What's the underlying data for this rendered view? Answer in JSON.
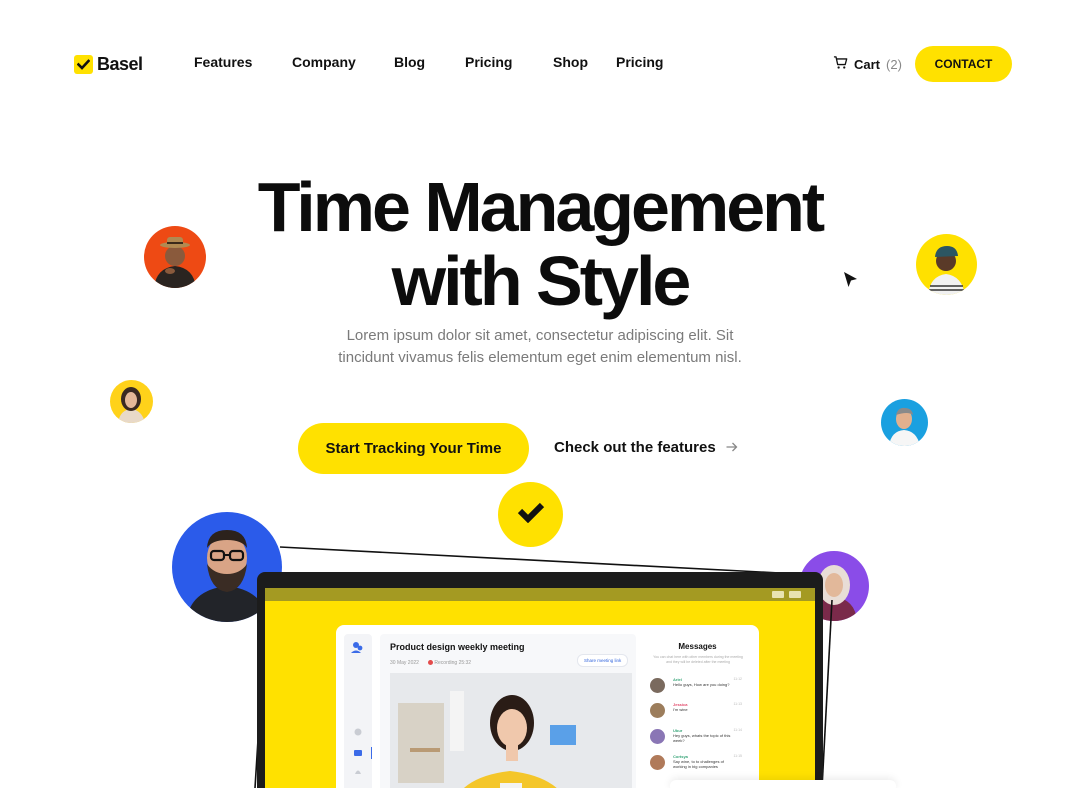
{
  "brand": {
    "name": "Basel",
    "accent": "#ffe100"
  },
  "nav": {
    "links": [
      "Features",
      "Company",
      "Blog",
      "Pricing",
      "Shop",
      "Pricing"
    ],
    "cart_label": "Cart",
    "cart_count": "(2)",
    "contact_label": "CONTACT"
  },
  "hero": {
    "headline_line1": "Time Management",
    "headline_line2": "with Style",
    "subtext": "Lorem ipsum dolor sit amet, consectetur adipiscing elit. Sit tincidunt vivamus felis elementum eget enim elementum nisl.",
    "primary_cta": "Start Tracking Your Time",
    "secondary_cta": "Check out the features"
  },
  "app": {
    "meeting_title": "Product design weekly meeting",
    "meeting_date": "30 May 2022",
    "recording": "Recording 25:32",
    "share_label": "Share meeting link",
    "messages_title": "Messages",
    "messages_sub": "You can chat here with other members during the meeting and they will be deleted after the meeting",
    "messages": [
      {
        "name": "Ariel",
        "text": "Hello guys, How are you doing?",
        "time": "11:12",
        "name_color": "#3aa67a",
        "avatar_color": "#7a6a5e"
      },
      {
        "name": "Jessica",
        "text": "I'm wine",
        "time": "11:13",
        "name_color": "#e24a6b",
        "avatar_color": "#9c7d5c"
      },
      {
        "name": "Ubur",
        "text": "Hey guys, whats the topic of this week?",
        "time": "11:14",
        "name_color": "#3aa67a",
        "avatar_color": "#8a76b5"
      },
      {
        "name": "Cortsya",
        "text": "Say wine, to to challenges of working in big companies",
        "time": "11:15",
        "name_color": "#3aa67a",
        "avatar_color": "#b07a5a"
      }
    ]
  }
}
